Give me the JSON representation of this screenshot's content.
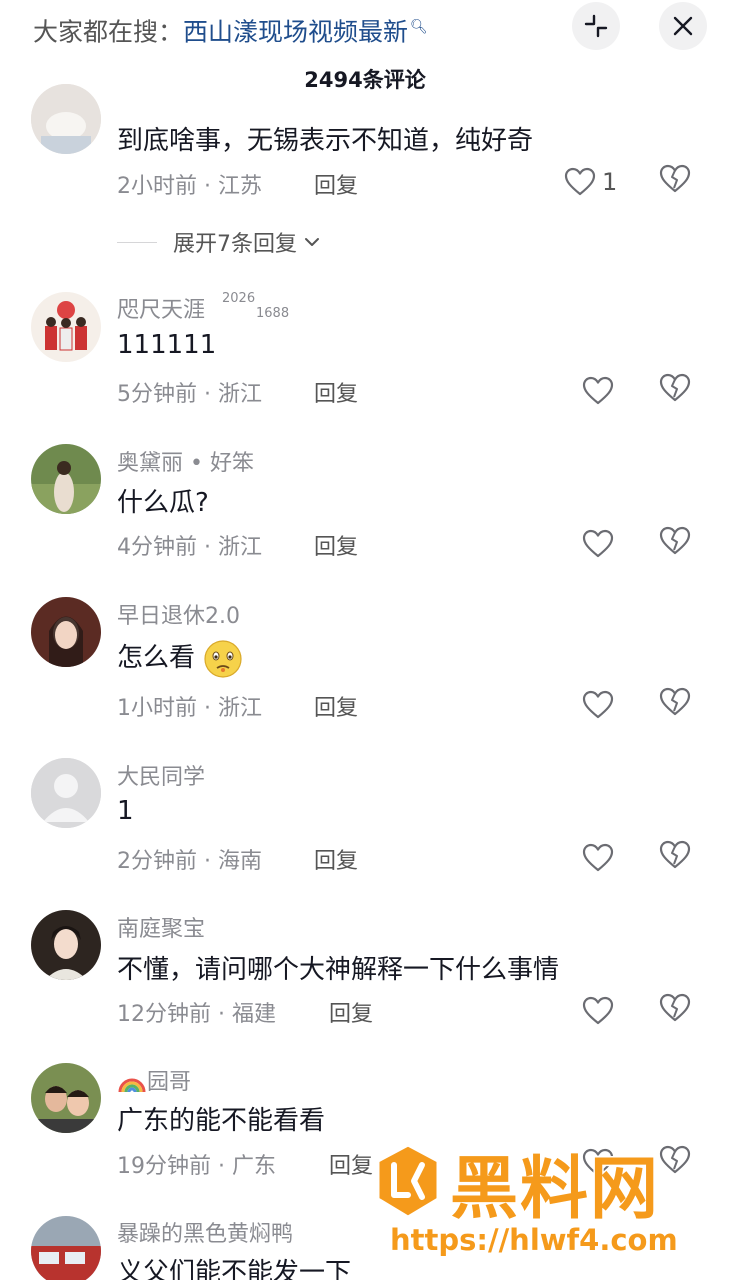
{
  "header": {
    "search_prefix": "大家都在搜：",
    "search_term": "西山漾现场视频最新",
    "comment_count": "2494条评论"
  },
  "comments": [
    {
      "text": "到底啥事，无锡表示不知道，纯好奇",
      "time": "2小时前",
      "location": "江苏",
      "reply_label": "回复",
      "likes": "1",
      "expand_label": "展开7条回复"
    },
    {
      "name": "咫尺天涯",
      "badge_top": "2026",
      "badge_bottom": "1688",
      "text": "111111",
      "time": "5分钟前",
      "location": "浙江",
      "reply_label": "回复"
    },
    {
      "name": "奥黛丽 • 好笨",
      "text": "什么瓜?",
      "time": "4分钟前",
      "location": "浙江",
      "reply_label": "回复"
    },
    {
      "name": "早日退休2.0",
      "text": "怎么看",
      "time": "1小时前",
      "location": "浙江",
      "reply_label": "回复"
    },
    {
      "name": "大民同学",
      "text": "1",
      "time": "2分钟前",
      "location": "海南",
      "reply_label": "回复"
    },
    {
      "name": "南庭聚宝",
      "text": "不懂，请问哪个大神解释一下什么事情",
      "time": "12分钟前",
      "location": "福建",
      "reply_label": "回复"
    },
    {
      "name": "园哥",
      "text": "广东的能不能看看",
      "time": "19分钟前",
      "location": "广东",
      "reply_label": "回复"
    },
    {
      "name": "暴躁的黑色黄焖鸭",
      "text": "义父们能不能发一下"
    }
  ],
  "watermark": {
    "title": "黑料网",
    "url": "https://hlwf4.com"
  },
  "colors": {
    "accent_link": "#1f4d8c",
    "watermark_orange": "#f59a1b",
    "muted_text": "#8a8b91"
  },
  "icons": [
    "search-icon",
    "collapse-icon",
    "close-icon",
    "heart-icon",
    "broken-heart-icon",
    "chevron-down-icon",
    "rainbow-icon",
    "worried-face-emoji"
  ]
}
